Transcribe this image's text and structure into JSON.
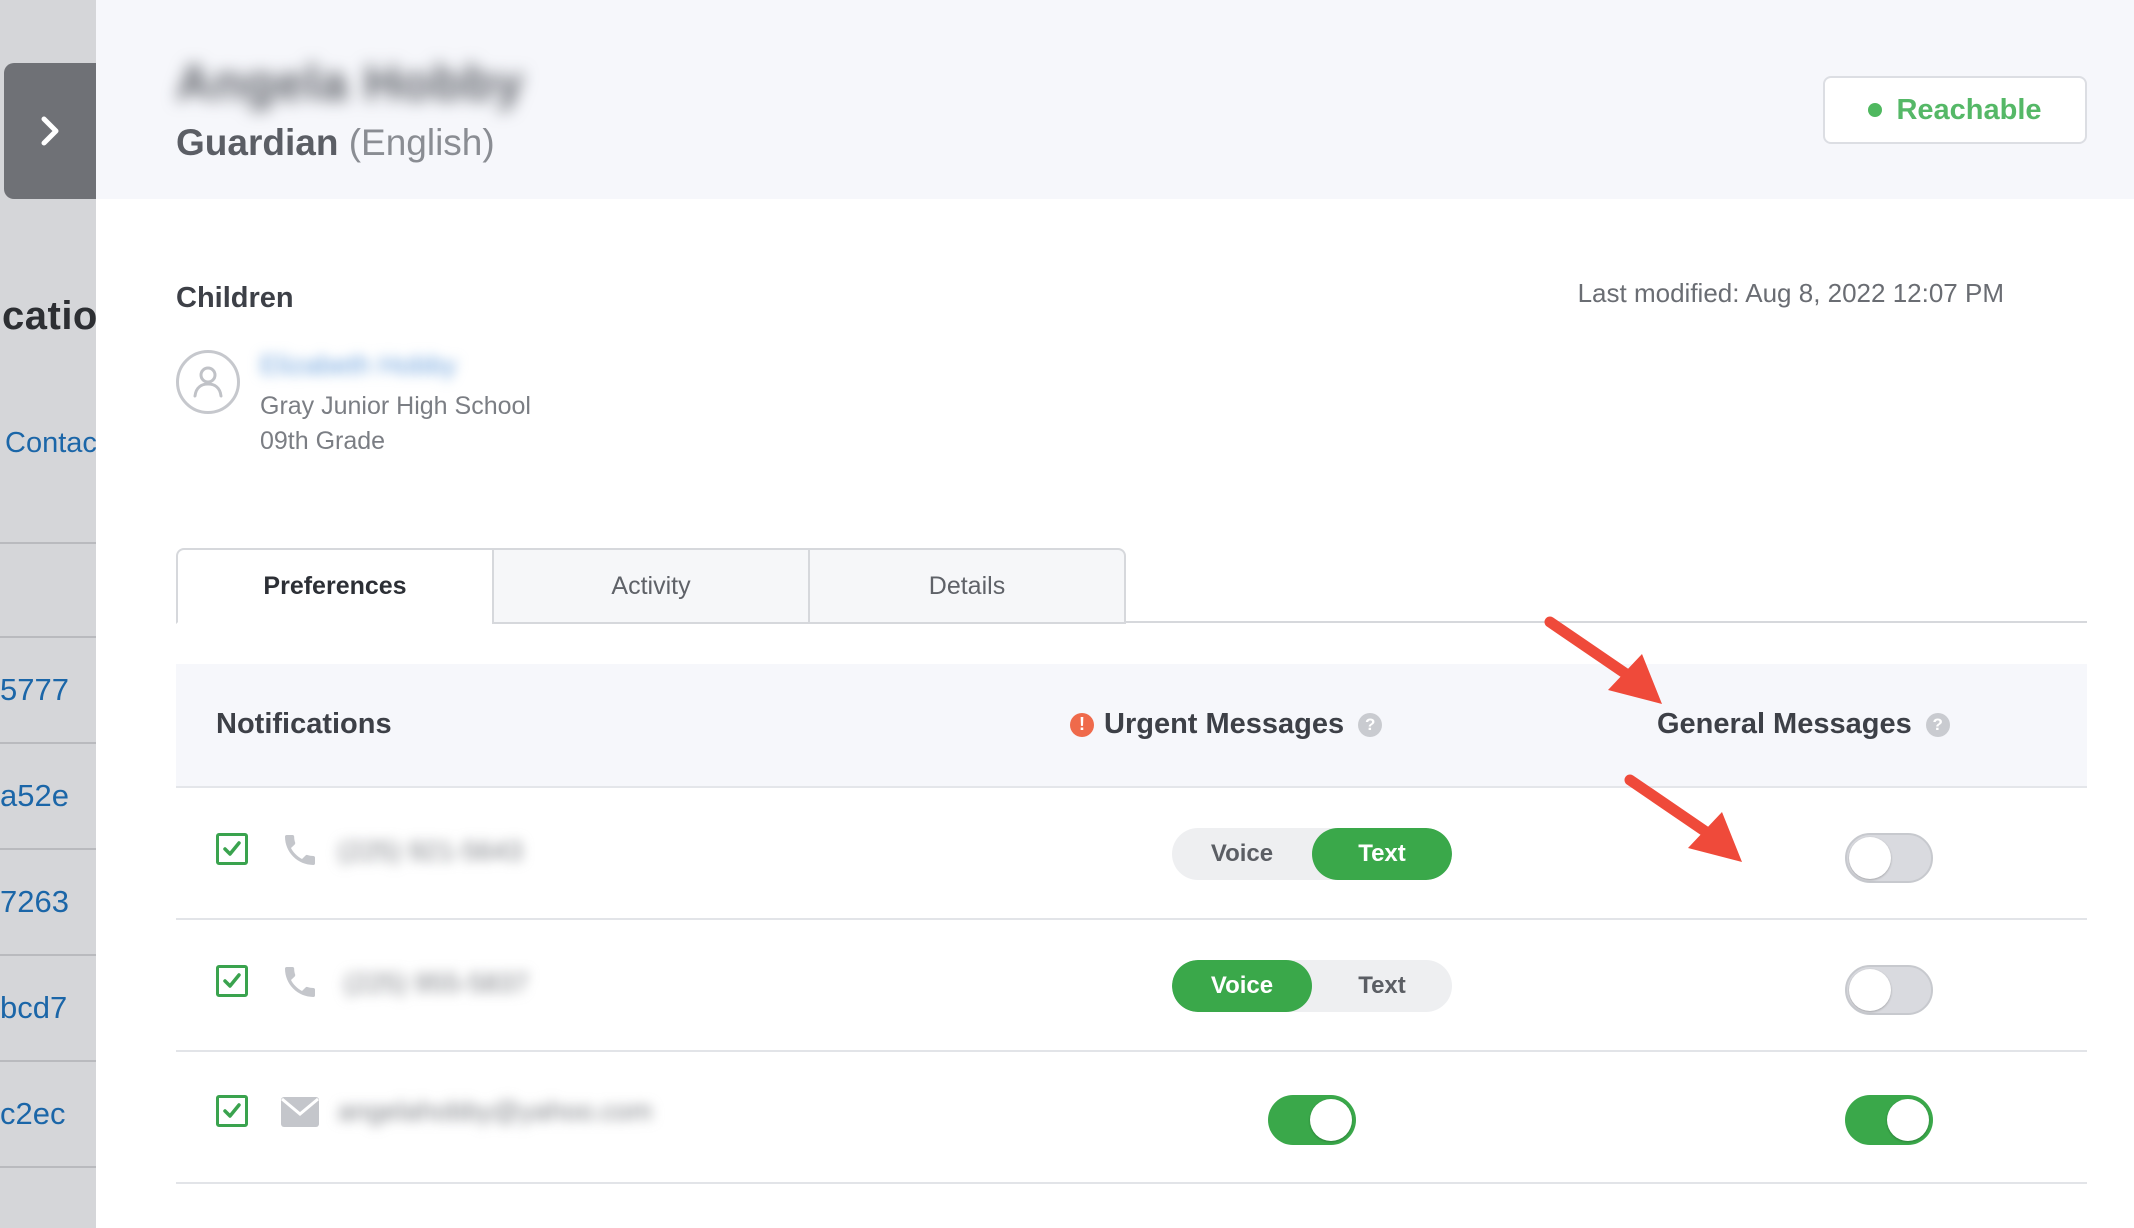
{
  "background": {
    "title_fragment": "catio",
    "link_fragment": "Contac",
    "row_fragments": [
      "5777",
      "a52e",
      "7263",
      "bcd7",
      "c2ec"
    ]
  },
  "header": {
    "contact_name": "Angela Hobby",
    "role": "Guardian",
    "language": "(English)",
    "status_label": "Reachable",
    "status_color": "#4fb85f"
  },
  "children": {
    "label": "Children",
    "last_modified": "Last modified: Aug 8, 2022 12:07 PM",
    "child_name": "Elizabeth Hobby",
    "school": "Gray Junior High School",
    "grade": "09th Grade"
  },
  "tabs": [
    {
      "label": "Preferences",
      "active": true
    },
    {
      "label": "Activity",
      "active": false
    },
    {
      "label": "Details",
      "active": false
    }
  ],
  "table": {
    "headers": {
      "notifications": "Notifications",
      "urgent": "Urgent Messages",
      "general": "General Messages"
    },
    "rows": [
      {
        "checked": true,
        "channel_icon": "phone-icon",
        "value": "(225) 921-5643",
        "urgent_type": "segmented",
        "urgent_selected": "Text",
        "general_enabled": false
      },
      {
        "checked": true,
        "channel_icon": "phone-icon",
        "value": "(225) 955-5837",
        "urgent_type": "segmented",
        "urgent_selected": "Voice",
        "general_enabled": false
      },
      {
        "checked": true,
        "channel_icon": "mail-icon",
        "value": "angelahobby@yahoo.com",
        "urgent_type": "toggle",
        "urgent_enabled": true,
        "general_enabled": true
      }
    ],
    "segment_labels": {
      "voice": "Voice",
      "text": "Text"
    }
  },
  "colors": {
    "accent_green": "#3aa84a",
    "urgent_red": "#ef6a4b",
    "annotation_arrow": "#ef4a3a"
  }
}
